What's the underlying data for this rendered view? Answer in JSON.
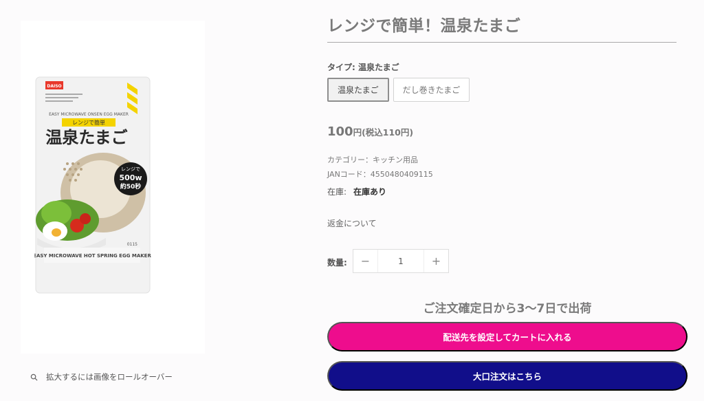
{
  "gallery": {
    "zoom_hint": "拡大するには画像をロールオーバー",
    "photo": {
      "brand": "DAISO",
      "cover_heading": "温泉たまご",
      "sub_banner": "レンジで簡単",
      "en_banner": "EASY MICROWAVE ONSEN EGG MAKER",
      "badge_top": "レンジで",
      "badge_watt": "500w",
      "badge_time": "約50秒",
      "bottom_label": "EASY MICROWAVE HOT SPRING EGG MAKER",
      "item_no": "0115"
    }
  },
  "product": {
    "title": "レンジで簡単！温泉たまご",
    "type_label": "タイプ: 温泉たまご",
    "variants": [
      "温泉たまご",
      "だし巻きたまご"
    ],
    "price": "100",
    "price_unit": "円(税込110円)",
    "category": "カテゴリー：キッチン用品",
    "jan": "JANコード：4550480409115",
    "stock_label": "在庫:",
    "stock_value": "在庫あり",
    "refund_link": "返金について",
    "quantity_label": "数量:",
    "quantity_value": "1",
    "minus": "−",
    "plus": "+",
    "shipping_note": "ご注文確定日から3〜7日で出荷",
    "cart_button": "配送先を設定してカートに入れる",
    "bulk_button": "大口注文はこちら"
  },
  "colors": {
    "cart_button": "#ee0d8d",
    "bulk_button": "#110e8a"
  }
}
